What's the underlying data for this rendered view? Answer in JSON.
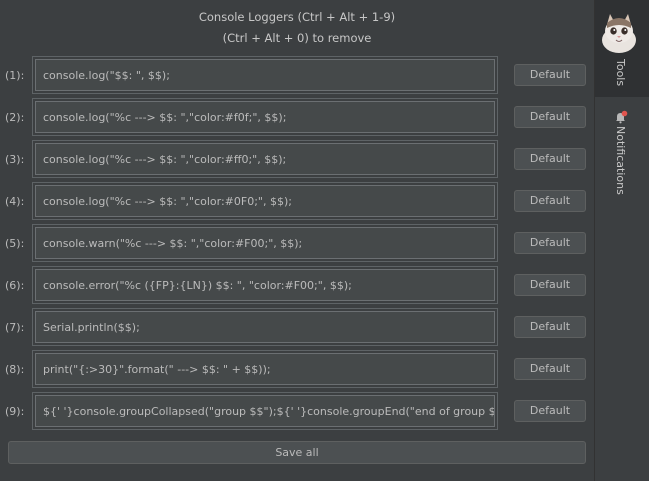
{
  "header": {
    "title": "Console Loggers (Ctrl + Alt + 1-9)",
    "subtitle": "(Ctrl + Alt + 0) to remove"
  },
  "rows": [
    {
      "label": "(1):",
      "value": "console.log(\"$$: \", $$);",
      "button": "Default"
    },
    {
      "label": "(2):",
      "value": "console.log(\"%c ---> $$: \",\"color:#f0f;\", $$);",
      "button": "Default"
    },
    {
      "label": "(3):",
      "value": "console.log(\"%c ---> $$: \",\"color:#ff0;\", $$);",
      "button": "Default"
    },
    {
      "label": "(4):",
      "value": "console.log(\"%c ---> $$: \",\"color:#0F0;\", $$);",
      "button": "Default"
    },
    {
      "label": "(5):",
      "value": "console.warn(\"%c ---> $$: \",\"color:#F00;\", $$);",
      "button": "Default"
    },
    {
      "label": "(6):",
      "value": "console.error(\"%c ({FP}:{LN}) $$: \", \"color:#F00;\", $$);",
      "button": "Default"
    },
    {
      "label": "(7):",
      "value": "Serial.println($$);",
      "button": "Default"
    },
    {
      "label": "(8):",
      "value": "print(\"{:>30}\".format(\" ---> $$: \" + $$));",
      "button": "Default"
    },
    {
      "label": "(9):",
      "value": "${' '}console.groupCollapsed(\"group $$\");${' '}console.groupEnd(\"end of group $$\");",
      "button": "Default"
    }
  ],
  "footer": {
    "save_label": "Save all"
  },
  "sidebar": {
    "tools_label": "Tools",
    "notifications_label": "Notifications"
  },
  "colors": {
    "background": "#3c3f41",
    "field": "#45494a",
    "notification_dot": "#e0554f"
  }
}
